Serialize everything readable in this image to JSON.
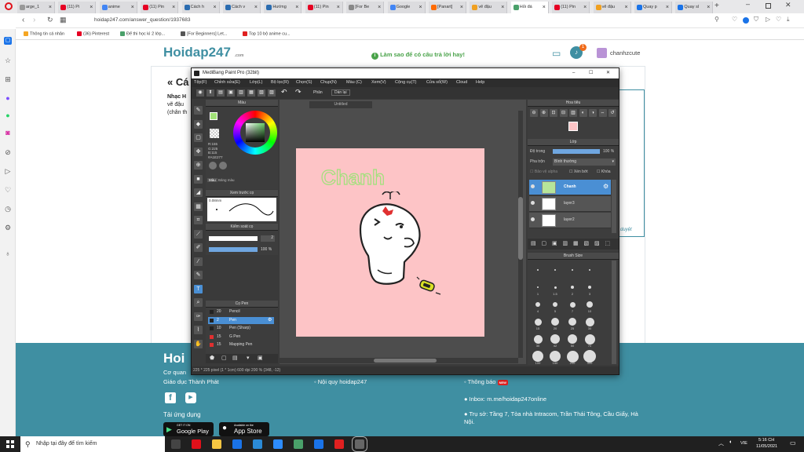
{
  "browser": {
    "tabs": [
      "arge_1",
      "(11) Pi",
      "anime",
      "(11) Pin",
      "Cách h",
      "Cách v",
      "Hướng",
      "(11) Pin",
      "[For Be",
      "Google",
      "[Panart]",
      "vẽ đậu",
      "Hỏi đá",
      "(11) Pin",
      "vẽ đậu",
      "Quay p",
      "Quay sl"
    ],
    "tab_colors": [
      "#999999",
      "#e60023",
      "#4285f4",
      "#e60023",
      "#2b6cb0",
      "#2b6cb0",
      "#2b6cb0",
      "#e60023",
      "#888888",
      "#4285f4",
      "#ff6b00",
      "#f0a020",
      "#4aa06a",
      "#e60023",
      "#f0a020",
      "#1a73e8",
      "#1a73e8"
    ],
    "url": "hoidap247.com/answer_question/1937683",
    "bookmarks": [
      "Thông tin cá nhân",
      "(36) Pinterest",
      "Để thi học kì 2 lớp...",
      "[For Beginners] Let...",
      "Top 10 bộ anime cu..."
    ]
  },
  "site": {
    "logo": "Hoidap247",
    "logo_sub": ".com",
    "help": "Làm sao để có câu trả lời hay!",
    "username": "chanhzcute",
    "badge": "1",
    "question_head": "« Cá",
    "question_lines": [
      "Nhạc H",
      "vẽ đậu",
      "(chân th"
    ],
    "side_link": "duyệt",
    "footer": {
      "logo": "Hoi",
      "col1": [
        "Cơ quan",
        "Giáo dục Thành Phát"
      ],
      "col2": "Nội quy hoidap247",
      "col3": "Thông báo",
      "new_badge": "NEW",
      "download": "Tải ứng dụng",
      "google": "Google Play",
      "google_small": "GET IT ON",
      "apple": "App Store",
      "apple_small": "Available on the",
      "inbox": "Inbox: m.me/hoidap247online",
      "address1": "Trụ sở: Tầng 7, Tòa nhà Intracom, Trần Thái Tông, Cầu Giấy, Hà",
      "address2": "Nội."
    }
  },
  "app": {
    "title": "MediBang Paint Pro (32bit)",
    "menu": [
      "Tệp(F)",
      "Chỉnh sửa(E)",
      "Lớp(L)",
      "Bộ lọc(R)",
      "Chọn(S)",
      "Chụp(N)",
      "Màu (C)",
      "Xem(V)",
      "Cộng cụ(T)",
      "Cửa sổ(W)",
      "Cloud",
      "Help"
    ],
    "toolbar_label": "Phân",
    "toolbar_btn": "Dán lại",
    "canvas_tab": "Untitled",
    "color_panel": "Màu",
    "color_values": [
      "R:155",
      "G:225",
      "B:115",
      "#A1E277"
    ],
    "color_tabs": [
      "Màu",
      "Bảng màu"
    ],
    "brush_preview": "Xem trước cọ",
    "brush_size_text": "0.08mm",
    "brush_control": "Kiểm soát cọ",
    "size_value": "2",
    "opacity_value": "100 %",
    "pen_panel": "Cọ Pen",
    "brushes": [
      {
        "num": "20",
        "name": "Pencil",
        "color": "#222222"
      },
      {
        "num": "2",
        "name": "Pen",
        "color": "#222222"
      },
      {
        "num": "10",
        "name": "Pen (Sharp)",
        "color": "#222222"
      },
      {
        "num": "15",
        "name": "G Pen",
        "color": "#e03030"
      },
      {
        "num": "15",
        "name": "Mapping Pen",
        "color": "#e03030"
      }
    ],
    "status": "225 * 225 pixel  (1 * 1cm)  600 dpi  200 %  (348, -12)",
    "navigator": "Hoa tiêu",
    "layer_panel": "Lớp",
    "opacity_label": "Độ trong",
    "opacity_layer": "100 %",
    "blend_label": "Pha trộn",
    "blend_value": "Bình thường",
    "checks": [
      "Bảo vệ alpha",
      "Xén bớt",
      "Khóa"
    ],
    "layers": [
      "Chanh",
      "layer3",
      "layer2"
    ],
    "brush_size_panel": "Brush Size",
    "brush_sizes": [
      "",
      "",
      "",
      "",
      "1",
      "1.5",
      "2",
      "3",
      "4",
      "5",
      "7",
      "10",
      "15",
      "20",
      "25",
      "30",
      "30",
      "42",
      "50",
      "70",
      "100",
      "150",
      "200",
      "300"
    ],
    "canvas_text": "Chanh",
    "colors": {
      "canvas": "#fdc4c6",
      "text": "#9fe27a",
      "accent": "#4a8fd4"
    }
  },
  "taskbar": {
    "search": "Nhập tại đây để tìm kiếm",
    "time": "5:16 CH",
    "date": "11/05/2021",
    "lang": "VIE"
  }
}
